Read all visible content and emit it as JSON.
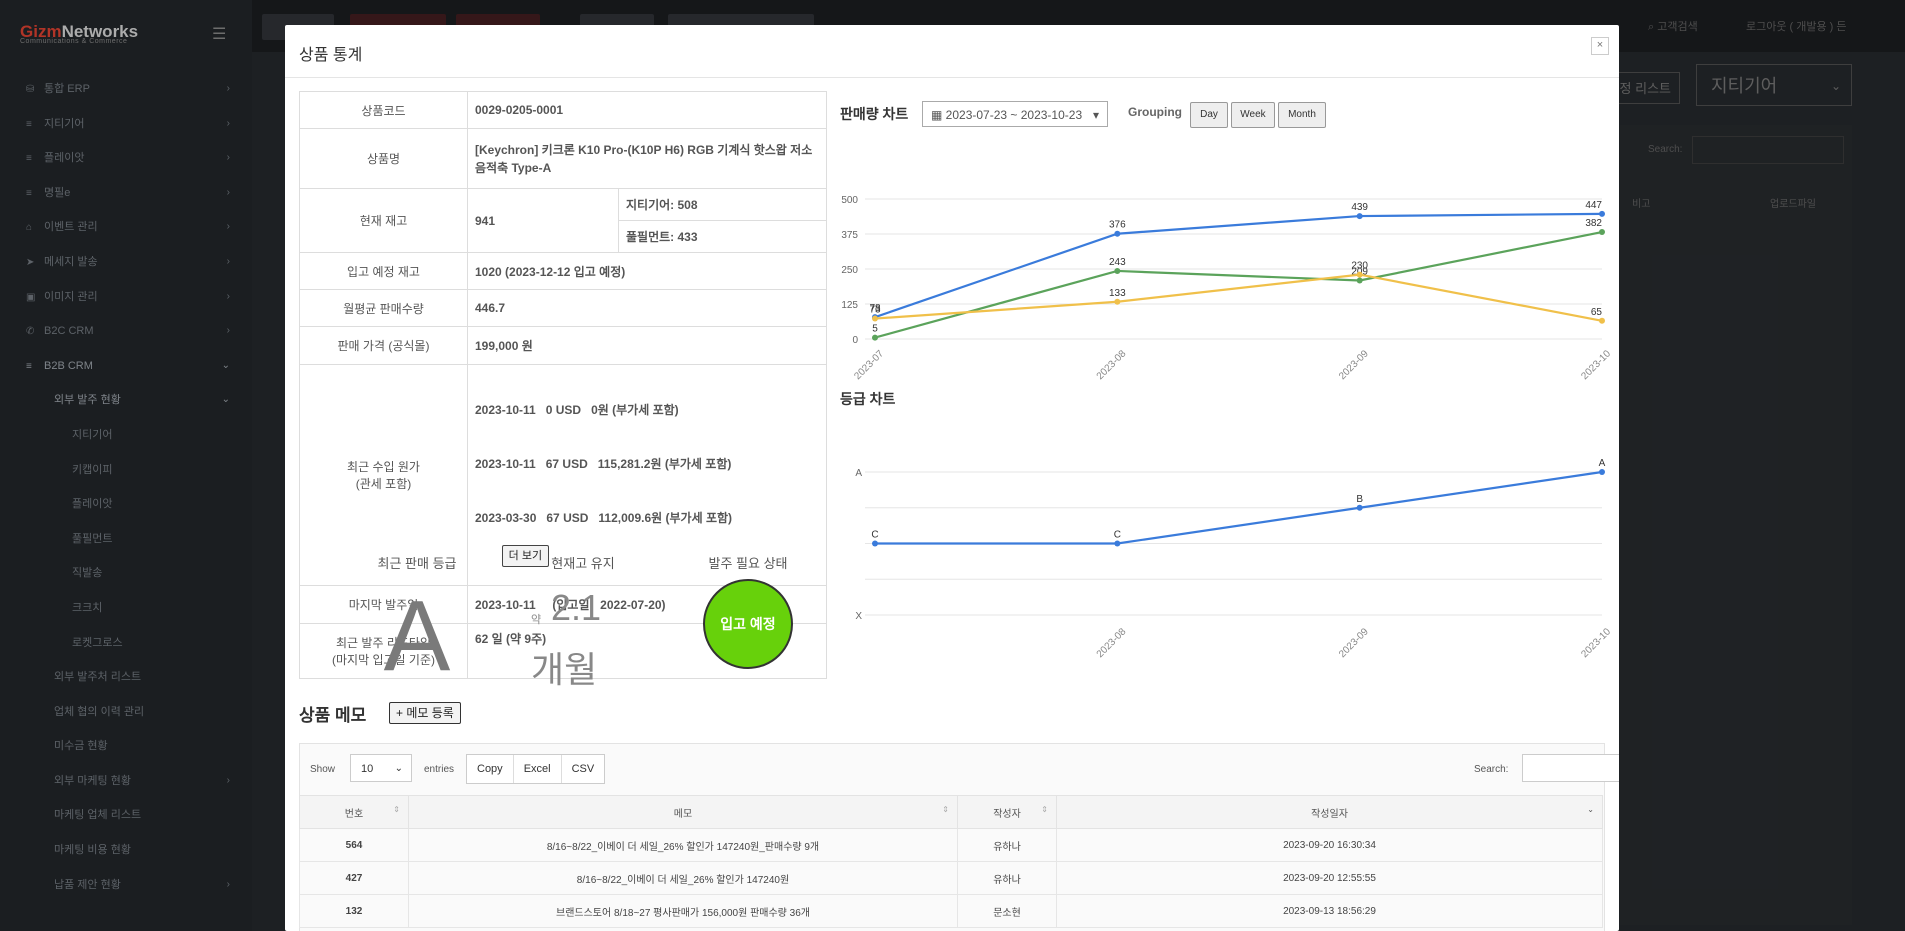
{
  "background": {
    "brand": {
      "accent": "Gizm",
      "name": "Networks",
      "subtitle": "Communications & Commerce"
    },
    "nav": [
      {
        "label": "통합 ERP",
        "icon": "database-icon",
        "arrow": "›",
        "level": 1
      },
      {
        "label": "지티기어",
        "icon": "list-icon",
        "arrow": "›",
        "level": 1
      },
      {
        "label": "플레이앗",
        "icon": "list-icon",
        "arrow": "›",
        "level": 1
      },
      {
        "label": "명필e",
        "icon": "list-icon",
        "arrow": "›",
        "level": 1
      },
      {
        "label": "이벤트 관리",
        "icon": "gift-icon",
        "arrow": "›",
        "level": 1
      },
      {
        "label": "메세지 발송",
        "icon": "send-icon",
        "arrow": "›",
        "level": 1
      },
      {
        "label": "이미지 관리",
        "icon": "image-icon",
        "arrow": "›",
        "level": 1
      },
      {
        "label": "B2C CRM",
        "icon": "phone-icon",
        "arrow": "›",
        "level": 1
      },
      {
        "label": "B2B CRM",
        "icon": "list-icon",
        "arrow": "⌄",
        "level": 1,
        "active": true
      },
      {
        "label": "외부 발주 현황",
        "icon": "",
        "arrow": "⌄",
        "level": 2,
        "active": true
      },
      {
        "label": "지티기어",
        "icon": "",
        "arrow": "",
        "level": 3
      },
      {
        "label": "키캡이피",
        "icon": "",
        "arrow": "",
        "level": 3
      },
      {
        "label": "플레이앗",
        "icon": "",
        "arrow": "",
        "level": 3
      },
      {
        "label": "풀필먼트",
        "icon": "",
        "arrow": "",
        "level": 3
      },
      {
        "label": "직발송",
        "icon": "",
        "arrow": "",
        "level": 3
      },
      {
        "label": "크크치",
        "icon": "",
        "arrow": "",
        "level": 3
      },
      {
        "label": "로켓그로스",
        "icon": "",
        "arrow": "",
        "level": 3
      },
      {
        "label": "외부 발주처 리스트",
        "icon": "",
        "arrow": "",
        "level": 2
      },
      {
        "label": "업체 협의 이력 관리",
        "icon": "",
        "arrow": "",
        "level": 2
      },
      {
        "label": "미수금 현황",
        "icon": "",
        "arrow": "",
        "level": 2
      },
      {
        "label": "외부 마케팅 현황",
        "icon": "",
        "arrow": "›",
        "level": 2
      },
      {
        "label": "마케팅 업체 리스트",
        "icon": "",
        "arrow": "",
        "level": 2
      },
      {
        "label": "마케팅 비용 현황",
        "icon": "",
        "arrow": "",
        "level": 2
      },
      {
        "label": "납품 제안 현황",
        "icon": "",
        "arrow": "›",
        "level": 2
      }
    ],
    "topright_search": "고객검색",
    "topright_logout": "로그아웃 ( 개발용 ) 든",
    "selected_brand": "지티기어",
    "list_button": "정 리스트",
    "search_label": "Search:",
    "col_note": "비고",
    "col_upload": "업로드파일"
  },
  "modal": {
    "title": "상품 통계",
    "close_label": "×",
    "info": {
      "code_label": "상품코드",
      "code": "0029-0205-0001",
      "name_label": "상품명",
      "name": "[Keychron] 키크론 K10 Pro-(K10P H6) RGB 기계식 핫스왑 저소음적축 Type-A",
      "stock_label": "현재 재고",
      "stock": "941",
      "stock_gt": "지티기어: 508",
      "stock_fulfill": "풀필먼트: 433",
      "incoming_label": "입고 예정 재고",
      "incoming": "1020 (2023-12-12 입고 예정)",
      "avg_label": "월평균 판매수량",
      "avg": "446.7",
      "price_label": "판매 가격 (공식몰)",
      "price": "199,000 원",
      "cost_label_1": "최근 수입 원가",
      "cost_label_2": "(관세 포함)",
      "cost_lines": [
        "2023-10-11   0 USD   0원 (부가세 포함)",
        "2023-10-11   67 USD   115,281.2원 (부가세 포함)",
        "2023-03-30   67 USD   112,009.6원 (부가세 포함)"
      ],
      "more_label": "더 보기",
      "last_order_label": "마지막 발주일",
      "last_order": "2023-10-11     (입고일:  2022-07-20)",
      "lead_label_1": "최근 발주 리드타임",
      "lead_label_2": "(마지막 입고일 기준)",
      "lead": "62 일 (약 9주)"
    },
    "stats": {
      "grade_label": "최근 판매 등급",
      "grade": "A",
      "months_label": "현재고 유지",
      "months_approx": "약",
      "months_value": "2.1",
      "months_unit": "개월",
      "order_label": "발주 필요 상태",
      "order_status": "입고 예정",
      "order_color": "#67d10b"
    },
    "sales_chart": {
      "title": "판매량 차트",
      "date_range": "2023-07-23 ~ 2023-10-23",
      "grouping_label": "Grouping",
      "grouping": [
        "Day",
        "Week",
        "Month"
      ]
    },
    "grade_chart": {
      "title": "등급 차트"
    },
    "memo": {
      "title": "상품 메모",
      "add_label": "+ 메모 등록",
      "show_label": "Show",
      "entries_value": "10",
      "entries_label": "entries",
      "export_buttons": [
        "Copy",
        "Excel",
        "CSV"
      ],
      "search_label": "Search:",
      "columns": [
        "번호",
        "메모",
        "작성자",
        "작성일자"
      ],
      "rows": [
        {
          "no": "564",
          "memo": "8/16~8/22_이베이 더 세일_26% 할인가 147240원_판매수량 9개",
          "author": "유하나",
          "date": "2023-09-20 16:30:34"
        },
        {
          "no": "427",
          "memo": "8/16~8/22_이베이 더 세일_26% 할인가 147240원",
          "author": "유하나",
          "date": "2023-09-20 12:55:55"
        },
        {
          "no": "132",
          "memo": "브랜드스토어 8/18~27 평사판매가 156,000원 판매수량 36개",
          "author": "문소현",
          "date": "2023-09-13 18:56:29"
        }
      ]
    }
  },
  "chart_data": [
    {
      "type": "line",
      "title": "판매량 차트",
      "categories": [
        "2023-07",
        "2023-08",
        "2023-09",
        "2023-10"
      ],
      "ylim": [
        0,
        500
      ],
      "yticks": [
        0,
        125,
        250,
        375,
        500
      ],
      "grid": true,
      "series": [
        {
          "color": "#3a7bdb",
          "values": [
            78,
            376,
            439,
            447
          ]
        },
        {
          "color": "#5ba35b",
          "values": [
            5,
            243,
            209,
            382
          ]
        },
        {
          "color": "#f0c04a",
          "values": [
            73,
            133,
            230,
            65
          ]
        }
      ]
    },
    {
      "type": "line",
      "title": "등급 차트",
      "categories": [
        "2023-07",
        "2023-08",
        "2023-09",
        "2023-10"
      ],
      "visible_ticks": [
        "",
        "2023-08",
        "2023-09",
        "2023-10"
      ],
      "y_levels": [
        "A",
        "B",
        "C",
        "D",
        "X"
      ],
      "y_labels_shown": [
        "A",
        "X"
      ],
      "grid": true,
      "series": [
        {
          "color": "#3a7bdb",
          "values": [
            "C",
            "C",
            "B",
            "A"
          ]
        }
      ]
    }
  ]
}
